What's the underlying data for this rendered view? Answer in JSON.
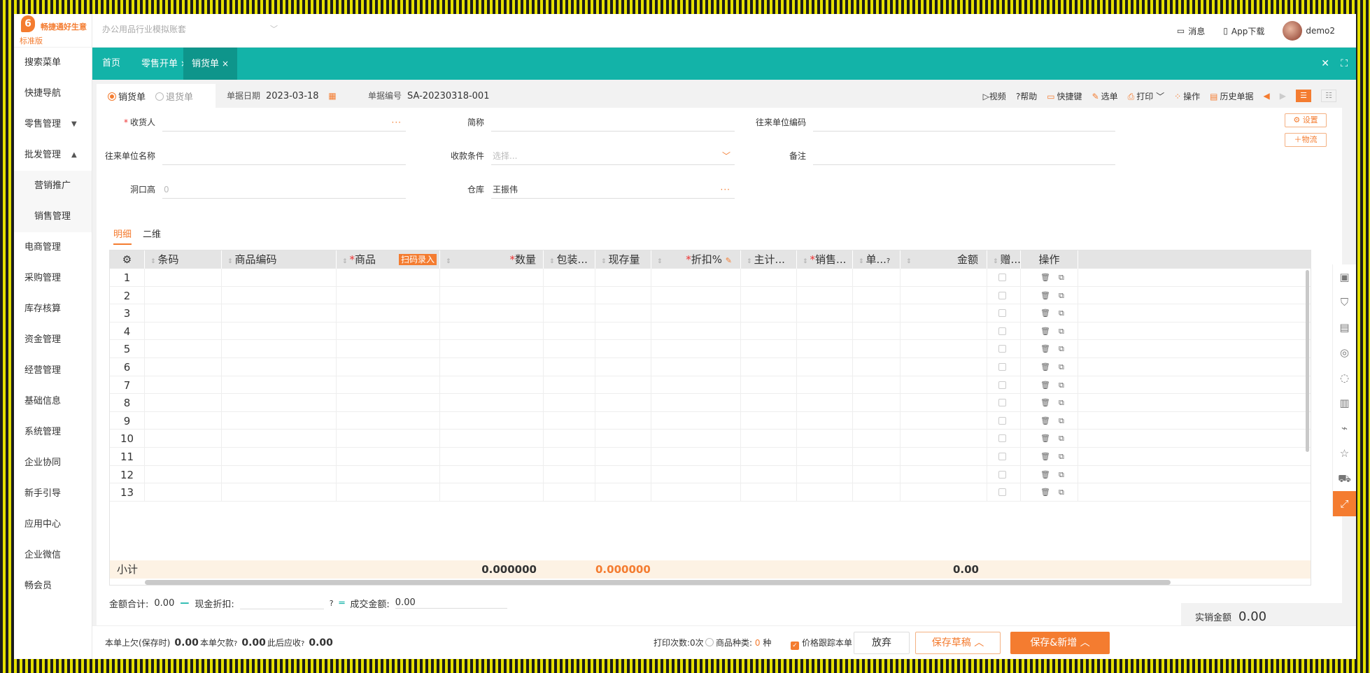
{
  "brand": {
    "name": "畅捷通好生意",
    "edition": "标准版",
    "mark": "6"
  },
  "account": {
    "placeholder": "办公用品行业模拟账套"
  },
  "top": {
    "messages": "消息",
    "app": "App下载",
    "user": "demo2"
  },
  "sidebar": {
    "items": [
      {
        "label": "搜索菜单"
      },
      {
        "label": "快捷导航"
      },
      {
        "label": "零售管理",
        "caret": "▼"
      },
      {
        "label": "批发管理",
        "caret": "▲"
      },
      {
        "label": "营销推广",
        "sub": true
      },
      {
        "label": "销售管理",
        "sub": true
      },
      {
        "label": "电商管理"
      },
      {
        "label": "采购管理"
      },
      {
        "label": "库存核算"
      },
      {
        "label": "资金管理"
      },
      {
        "label": "经营管理"
      },
      {
        "label": "基础信息"
      },
      {
        "label": "系统管理"
      },
      {
        "label": "企业协同"
      },
      {
        "label": "新手引导"
      },
      {
        "label": "应用中心"
      },
      {
        "label": "企业微信"
      },
      {
        "label": "畅会员"
      }
    ]
  },
  "tabs": [
    {
      "label": "首页"
    },
    {
      "label": "零售开单",
      "close": "×"
    },
    {
      "label": "销货单",
      "close": "×",
      "active": true
    }
  ],
  "doc": {
    "type_sale": "销货单",
    "type_return": "退货单",
    "date_label": "单据日期",
    "date": "2023-03-18",
    "no_label": "单据编号",
    "no": "SA-20230318-001"
  },
  "toolbar": [
    "视频",
    "帮助",
    "快捷键",
    "选单",
    "打印",
    "操作",
    "历史单据"
  ],
  "form": {
    "receiver": "收货人",
    "short": "简称",
    "partner_code": "往来单位编码",
    "partner_name": "往来单位名称",
    "terms": "收款条件",
    "terms_ph": "选择...",
    "remark": "备注",
    "cave": "洞口高",
    "cave_val": "0",
    "warehouse": "仓库",
    "warehouse_val": "王振伟",
    "settings": "设置",
    "logistics": "物流"
  },
  "detail_tabs": [
    "明细",
    "二维"
  ],
  "grid": {
    "headers": [
      "条码",
      "商品编码",
      "商品",
      "数量",
      "包装...",
      "现存量",
      "折扣%",
      "主计...",
      "销售...",
      "单...",
      "金额",
      "赠...",
      "操作"
    ],
    "scan": "扫码录入",
    "rows": [
      "1",
      "2",
      "3",
      "4",
      "5",
      "6",
      "7",
      "8",
      "9",
      "10",
      "11",
      "12",
      "13"
    ],
    "subtotal_label": "小计",
    "subtotal_qty": "0.000000",
    "subtotal_stock": "0.000000",
    "subtotal_amount": "0.00"
  },
  "sums": {
    "total_label": "金额合计:",
    "total": "0.00",
    "discount_label": "现金折扣:",
    "deal_label": "成交金额:",
    "deal": "0.00",
    "real_label": "实销金额",
    "real": "0.00"
  },
  "footer": {
    "prev_debt_label": "本单上欠(保存时)",
    "prev_debt": "0.00",
    "debt_label": "本单欠款",
    "debt": "0.00",
    "after_label": "此后应收",
    "after": "0.00",
    "print_count": "打印次数:0次",
    "kinds_label": "商品种类:",
    "kinds": "0",
    "kinds_unit": "种",
    "track": "价格跟踪本单",
    "discard": "放弃",
    "save_draft": "保存草稿",
    "save_new": "保存&新增"
  },
  "colors": {
    "accent": "#f47c30",
    "teal": "#13b3a8"
  }
}
